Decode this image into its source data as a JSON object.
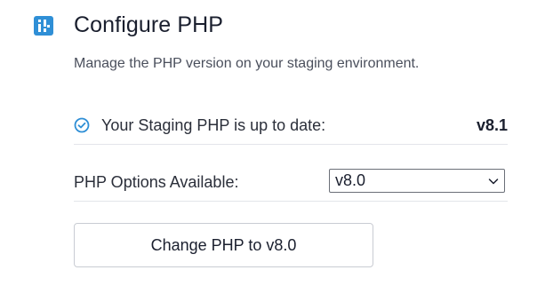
{
  "header": {
    "icon": "php-config-icon",
    "title": "Configure PHP"
  },
  "description": "Manage the PHP version on your staging environment.",
  "status": {
    "icon": "check-circle-icon",
    "label": "Your Staging PHP is up to date:",
    "value": "v8.1"
  },
  "options": {
    "label": "PHP Options Available:",
    "selected": "v8.0"
  },
  "actions": {
    "change_button_label": "Change PHP to v8.0"
  },
  "colors": {
    "accent": "#2f8fd6",
    "text": "#1a1f2e",
    "muted_text": "#4a4f5c",
    "divider": "#e3e5ea"
  }
}
